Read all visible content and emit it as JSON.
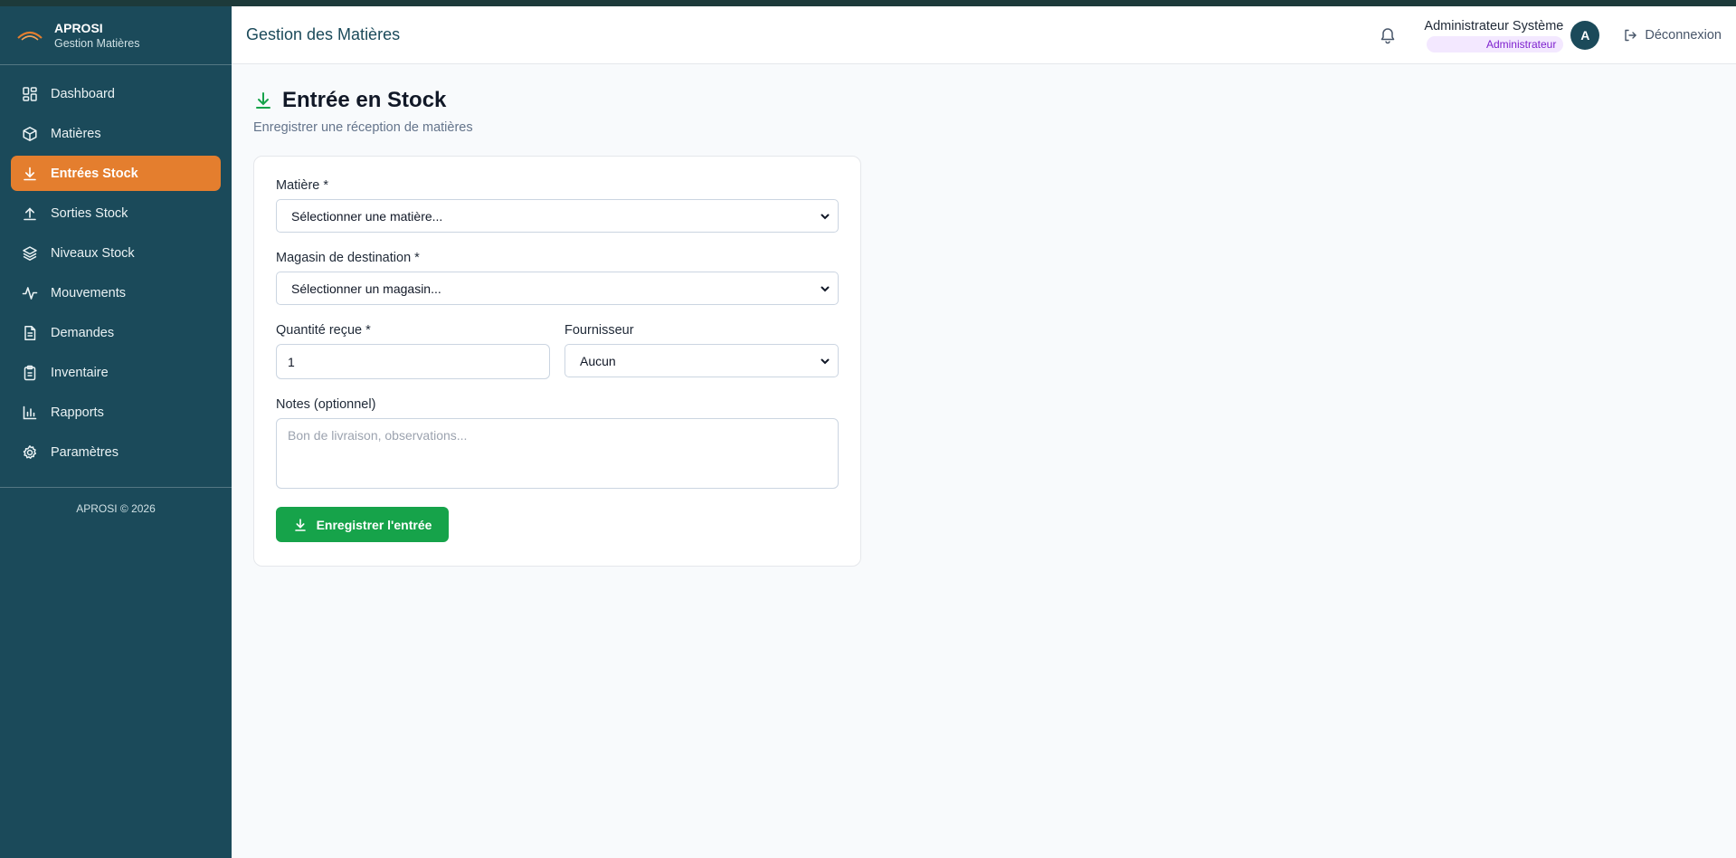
{
  "brand": {
    "name": "APROSI",
    "subtitle": "Gestion Matières"
  },
  "sidebar": {
    "items": [
      {
        "label": "Dashboard",
        "icon": "grid-icon"
      },
      {
        "label": "Matières",
        "icon": "box-icon"
      },
      {
        "label": "Entrées Stock",
        "icon": "download-icon",
        "active": true
      },
      {
        "label": "Sorties Stock",
        "icon": "upload-icon"
      },
      {
        "label": "Niveaux Stock",
        "icon": "layers-icon"
      },
      {
        "label": "Mouvements",
        "icon": "activity-icon"
      },
      {
        "label": "Demandes",
        "icon": "document-icon"
      },
      {
        "label": "Inventaire",
        "icon": "clipboard-icon"
      },
      {
        "label": "Rapports",
        "icon": "bar-chart-icon"
      },
      {
        "label": "Paramètres",
        "icon": "gear-icon"
      }
    ],
    "footer": "APROSI © 2026"
  },
  "header": {
    "title": "Gestion des Matières",
    "user_name": "Administrateur Système",
    "user_role": "Administrateur",
    "avatar_initial": "A",
    "logout_label": "Déconnexion"
  },
  "page": {
    "title": "Entrée en Stock",
    "subtitle": "Enregistrer une réception de matières"
  },
  "form": {
    "material_label": "Matière *",
    "material_value": "Sélectionner une matière...",
    "store_label": "Magasin de destination *",
    "store_value": "Sélectionner un magasin...",
    "quantity_label": "Quantité reçue *",
    "quantity_value": "1",
    "supplier_label": "Fournisseur",
    "supplier_value": "Aucun",
    "notes_label": "Notes (optionnel)",
    "notes_placeholder": "Bon de livraison, observations...",
    "submit_label": "Enregistrer l'entrée"
  },
  "colors": {
    "sidebar_bg": "#1b4a5a",
    "active_item": "#e47e2e",
    "primary_button": "#16a34a",
    "role_badge_bg": "#f3e8ff",
    "role_badge_text": "#7e22ce"
  }
}
